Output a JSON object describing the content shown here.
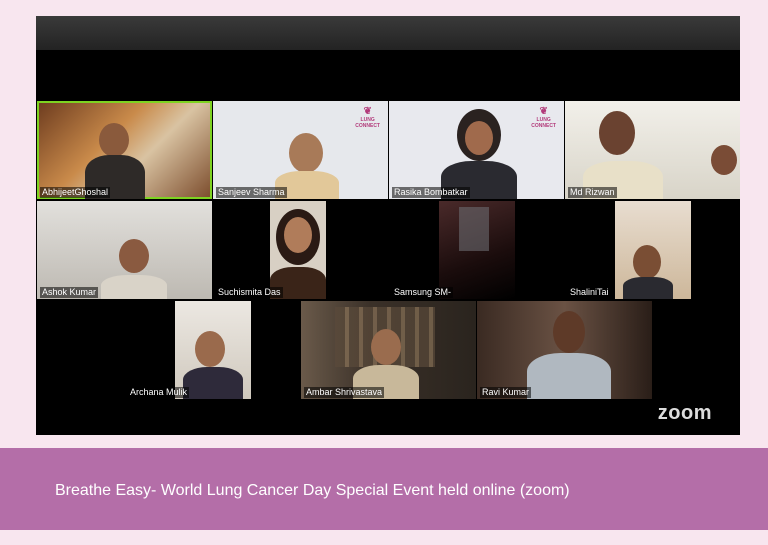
{
  "meeting": {
    "app": "zoom",
    "participants": [
      {
        "name": "AbhijeetGhoshal",
        "active_speaker": true
      },
      {
        "name": "Sanjeev Sharma"
      },
      {
        "name": "Rasika Bombatkar"
      },
      {
        "name": "Md Rizwan"
      },
      {
        "name": "Ashok Kumar"
      },
      {
        "name": "Suchismita Das"
      },
      {
        "name": "Samsung SM-"
      },
      {
        "name": "ShaliniTai"
      },
      {
        "name": "Archana Mulik"
      },
      {
        "name": "Ambar Shrivastava"
      },
      {
        "name": "Ravi Kumar"
      }
    ],
    "background_logo": {
      "line1": "LUNG",
      "line2": "CONNECT"
    }
  },
  "caption": "Breathe Easy- World Lung Cancer Day Special Event held online (zoom)",
  "colors": {
    "page_background": "#f8e6ef",
    "caption_band": "#b46ea8",
    "active_speaker_border": "#7ed321"
  }
}
